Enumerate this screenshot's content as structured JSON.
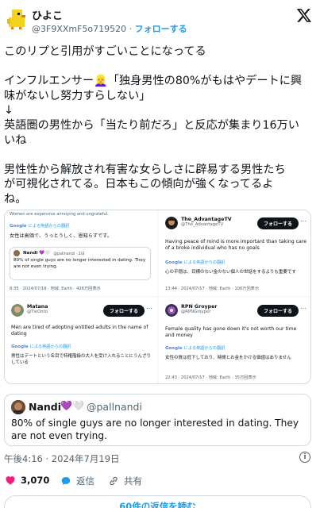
{
  "header": {
    "name": "ひよこ",
    "handle": "@3F9XXmF5o719520",
    "separator": "·",
    "follow_label": "フォローする"
  },
  "tweet": {
    "lines": [
      "このリプと引用がすごいことになってる",
      "",
      "インフルエンサー👱‍♀️「独身男性の80%がもはやデートに興",
      "味がないし努力すらしない」",
      "↓",
      "英語圏の男性から「当たり前だろ」と反応が集まり16万い",
      "いね",
      "",
      "男性性から解放され有害な女らしさに辟易する男性たち",
      "が可視化されてる。日本もこの傾向が強くなってるよ",
      "ね。"
    ]
  },
  "media": {
    "cell1": {
      "top_text": "Women are expensive annoying and ungrateful.",
      "translated_by": "による英語からの翻訳",
      "translation": "女性は高価で、うっとうしく、恩知らずです。",
      "quoted_name": "Nandi 💜🤍",
      "quoted_handle": "@pallnandi · 2日",
      "quoted_text": "80% of single guys are no longer interested in dating. They are not even trying.",
      "meta": "8:35 · 2024/07/18 · 地域: Earth · 426万回表示"
    },
    "cell2": {
      "name": "The_AdvantageTV",
      "handle": "@The_AdvantageTV",
      "follow_label": "フォローする",
      "text": "Having peace of mind is more important than taking care of a broke individual who has no goals",
      "translated_by": "による英語からの翻訳",
      "translation": "心の平穏は、目標のない金のない個人の世話をするよりも重要です",
      "meta": "13:44 · 2024/07/17 · 地域: Earth · 106万回表示"
    },
    "cell3": {
      "name": "Matana",
      "handle": "@TieOnto",
      "follow_label": "フォローする",
      "text": "Men are tired of adopting entitled adults in the name of dating",
      "translated_by": "による英語からの翻訳",
      "translation": "男性はデートという名目で特権階級の大人を受け入れることにうんざりしている"
    },
    "cell4": {
      "name": "RPN Groyper",
      "handle": "@RPNGroyper",
      "follow_label": "フォローする",
      "text": "Female quality has gone down it's not worth our time and money",
      "translated_by": "による英語からの翻訳",
      "translation": "女性の質は低下しており、時間とお金をかける価値はありません",
      "meta": "22:43 · 2024/07/17 · 地域: Earth · 35万回表示"
    },
    "google_label": "Google"
  },
  "quote": {
    "name": "Nandi",
    "hearts": "💜🤍",
    "handle": "@pallnandi",
    "text": "80% of single guys are no longer interested in dating. They are not even trying."
  },
  "timestamp": "午後4:16 · 2024年7月19日",
  "actions": {
    "likes": "3,070",
    "reply_label": "返信",
    "share_label": "共有"
  },
  "replies_label": "60件の返信を読む",
  "colors": {
    "accent": "#1d9bf0",
    "like": "#f91880",
    "text": "#0f1419",
    "muted": "#536471",
    "border": "#cfd9de"
  }
}
